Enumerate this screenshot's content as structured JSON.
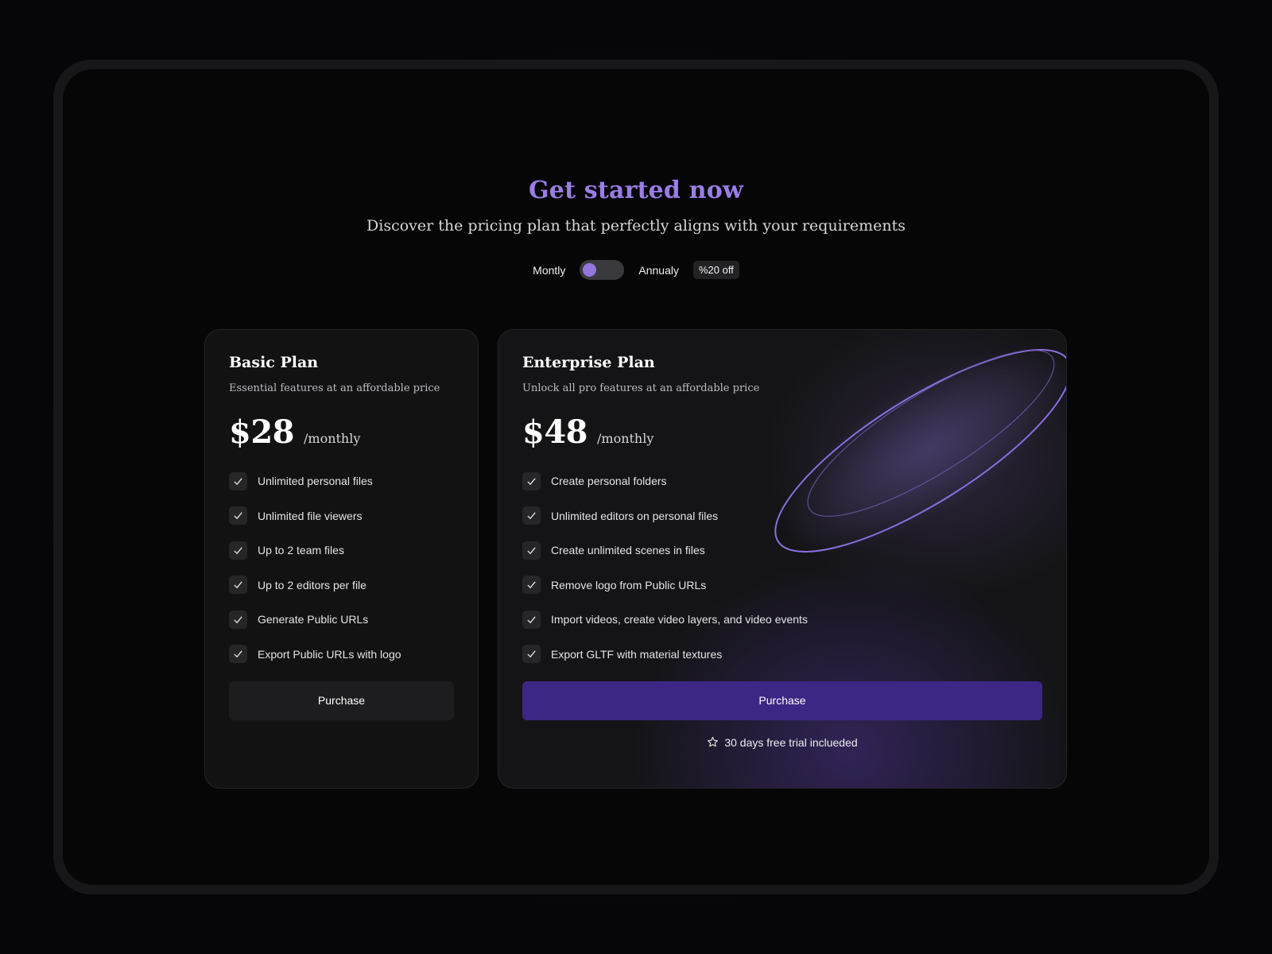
{
  "hero": {
    "title": "Get started now",
    "subtitle": "Discover the pricing plan that perfectly aligns with your requirements"
  },
  "billing": {
    "monthly_label": "Montly",
    "annual_label": "Annualy",
    "discount_badge": "%20 off",
    "selected": "monthly"
  },
  "plans": [
    {
      "name": "Basic Plan",
      "description": "Essential features at an affordable price",
      "price": "$28",
      "period": "/monthly",
      "features": [
        "Unlimited personal files",
        "Unlimited file viewers",
        "Up to 2 team files",
        "Up to 2 editors per file",
        "Generate Public URLs",
        "Export Public URLs with logo"
      ],
      "button_label": "Purchase"
    },
    {
      "name": "Enterprise Plan",
      "description": "Unlock all pro features at an affordable price",
      "price": "$48",
      "period": "/monthly",
      "features": [
        "Create personal folders",
        "Unlimited editors on personal files",
        "Create unlimited scenes in files",
        "Remove logo from Public URLs",
        "Import videos, create video layers, and video events",
        "Export GLTF with material textures"
      ],
      "button_label": "Purchase",
      "trial_note": "30 days free trial inclueded"
    }
  ],
  "colors": {
    "accent": "#9b7de6",
    "enterprise_button": "#3d2785",
    "toggle_knob": "#9277dd"
  },
  "icons": {
    "feature_bullet": "check-icon",
    "trial": "star-icon"
  }
}
